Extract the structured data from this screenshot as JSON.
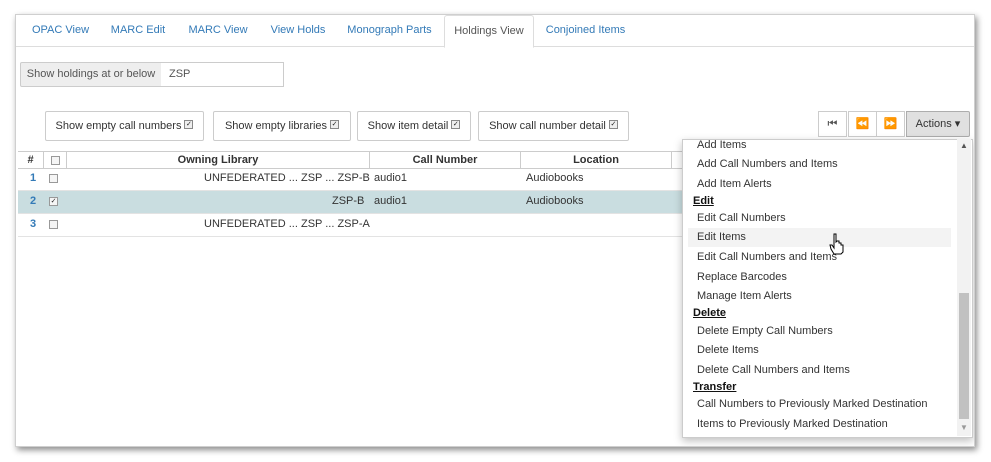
{
  "tabs": [
    "OPAC View",
    "MARC Edit",
    "MARC View",
    "View Holds",
    "Monograph Parts",
    "Holdings View",
    "Conjoined Items"
  ],
  "holdings_filter": {
    "label": "Show holdings at or below",
    "value": "ZSP"
  },
  "toggles": [
    "Show empty call numbers",
    "Show empty libraries",
    "Show item detail",
    "Show call number detail"
  ],
  "nav": {
    "first": "⏮",
    "prev": "⏪",
    "next": "⏩",
    "actions": "Actions ▾"
  },
  "grid": {
    "headers": [
      "#",
      "Owning Library",
      "Call Number",
      "Location"
    ],
    "rows": [
      {
        "num": "1",
        "library": "UNFEDERATED ... ZSP ... ZSP-B",
        "call_number": "audio1",
        "location": "Audiobooks",
        "checked": false
      },
      {
        "num": "2",
        "library": "ZSP-B",
        "call_number": "audio1",
        "location": "Audiobooks",
        "checked": true
      },
      {
        "num": "3",
        "library": "UNFEDERATED ... ZSP ... ZSP-A",
        "call_number": "",
        "location": "",
        "checked": false
      }
    ]
  },
  "actions_menu": {
    "add_items": "Add Items",
    "add_call_numbers_items": "Add Call Numbers and Items",
    "add_item_alerts": "Add Item Alerts",
    "edit_header": "Edit",
    "edit_call_numbers": "Edit Call Numbers",
    "edit_items": "Edit Items",
    "edit_call_numbers_items": "Edit Call Numbers and Items",
    "replace_barcodes": "Replace Barcodes",
    "manage_item_alerts": "Manage Item Alerts",
    "delete_header": "Delete",
    "delete_empty_call_numbers": "Delete Empty Call Numbers",
    "delete_items": "Delete Items",
    "delete_call_numbers_items": "Delete Call Numbers and Items",
    "transfer_header": "Transfer",
    "transfer_call_numbers": "Call Numbers to Previously Marked Destination",
    "transfer_items": "Items to Previously Marked Destination"
  }
}
